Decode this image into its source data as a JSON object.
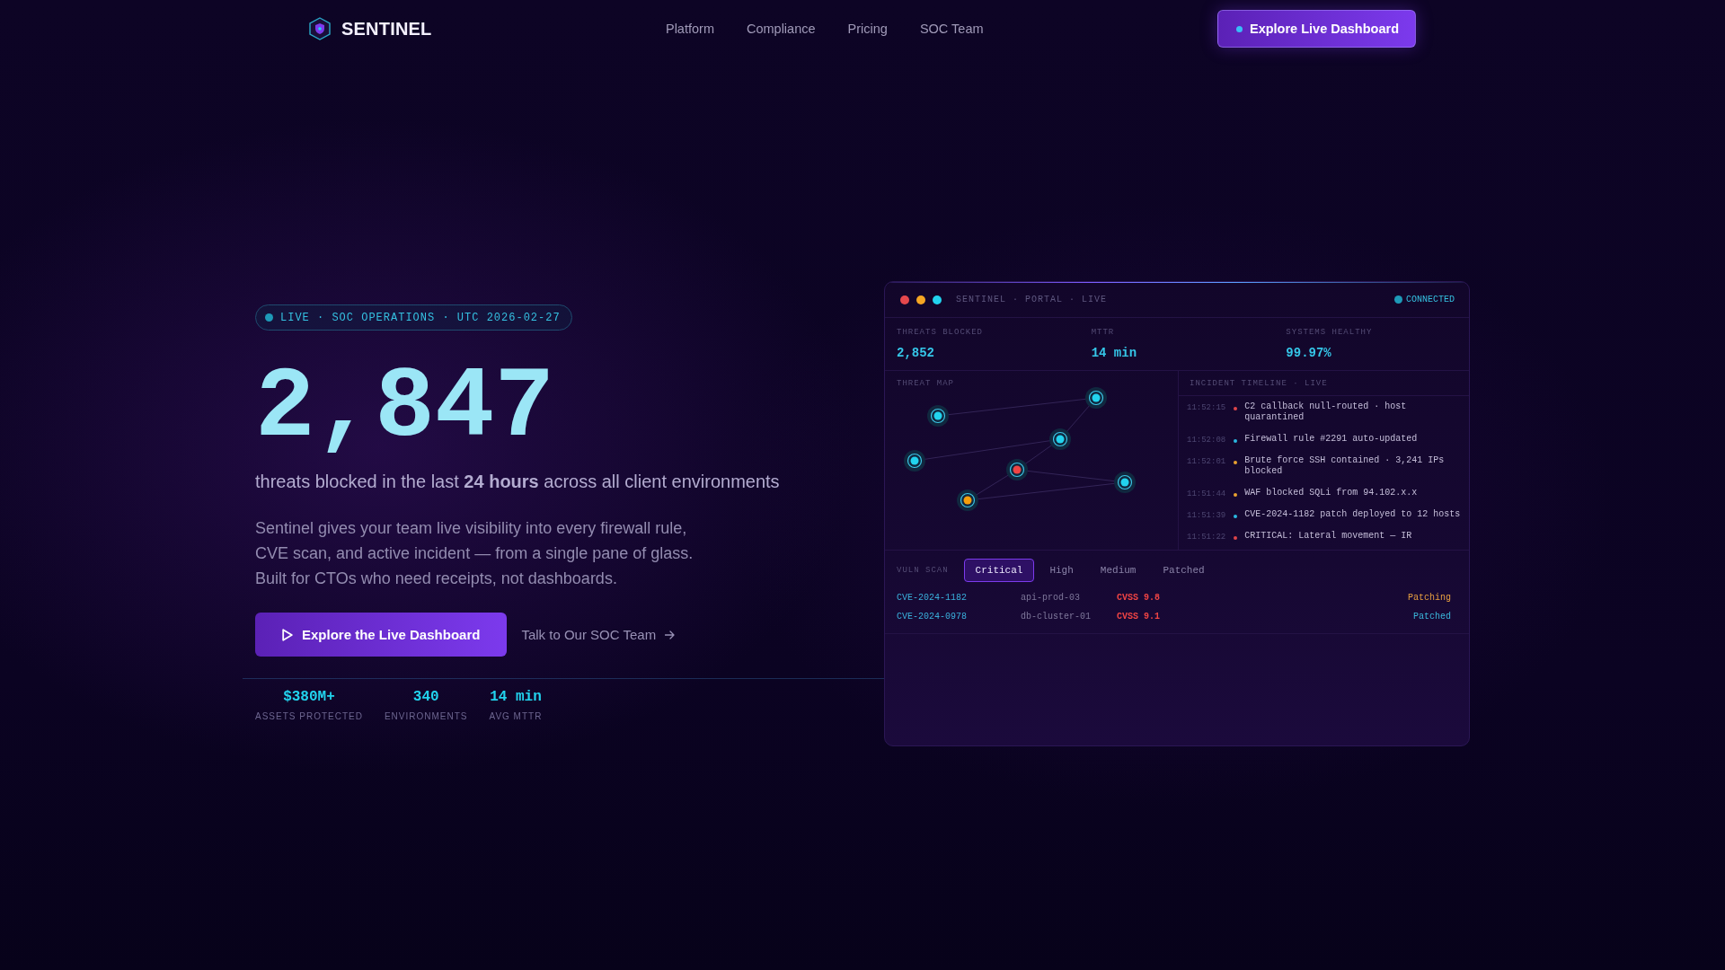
{
  "nav": {
    "brand": "SENTINEL",
    "links": [
      "Platform",
      "Compliance",
      "Pricing",
      "SOC Team"
    ],
    "cta": "Explore Live Dashboard"
  },
  "hero": {
    "badge": "LIVE · SOC OPERATIONS · UTC 2026-02-27",
    "count": "2,847",
    "subtitle": "threats blocked in the last **24 hours** across all client environments",
    "description": "Sentinel gives your team live visibility into every firewall rule, CVE scan, and active incident — from a single pane of glass. Built for CTOs who need receipts, not dashboards.",
    "primary_button": "Explore the Live Dashboard",
    "secondary_link": "Talk to Our SOC Team",
    "stats": [
      {
        "value": "$380M+",
        "label": "ASSETS PROTECTED"
      },
      {
        "value": "340",
        "label": "ENVIRONMENTS"
      },
      {
        "value": "14 min",
        "label": "AVG MTTR"
      }
    ]
  },
  "dashboard": {
    "title": "SENTINEL · PORTAL · LIVE",
    "status": "CONNECTED",
    "metrics": [
      {
        "label": "THREATS BLOCKED",
        "value": "2,852"
      },
      {
        "label": "MTTR",
        "value": "14 min"
      },
      {
        "label": "SYSTEMS HEALTHY",
        "value": "99.97%"
      }
    ],
    "threat_map": {
      "label": "THREAT MAP"
    },
    "timeline": {
      "title": "INCIDENT TIMELINE · LIVE",
      "events": [
        {
          "time": "11:52:15",
          "color": "#e0454a",
          "text": "C2 callback null-routed · host quarantined"
        },
        {
          "time": "11:52:08",
          "color": "#2ab8e0",
          "text": "Firewall rule #2291 auto-updated"
        },
        {
          "time": "11:52:01",
          "color": "#e8a030",
          "text": "Brute force SSH contained · 3,241 IPs blocked"
        },
        {
          "time": "11:51:44",
          "color": "#e8a030",
          "text": "WAF blocked SQLi from 94.102.x.x"
        },
        {
          "time": "11:51:39",
          "color": "#2ab8e0",
          "text": "CVE-2024-1182 patch deployed to 12 hosts"
        },
        {
          "time": "11:51:22",
          "color": "#e0454a",
          "text": "CRITICAL: Lateral movement — IR"
        }
      ]
    },
    "vuln_scan": {
      "label": "VULN SCAN",
      "tabs": [
        {
          "label": "Critical",
          "selected": true
        },
        {
          "label": "High",
          "selected": false
        },
        {
          "label": "Medium",
          "selected": false
        },
        {
          "label": "Patched",
          "selected": false
        }
      ],
      "rows": [
        {
          "cve": "CVE-2024-1182",
          "host": "api-prod-03",
          "score": "CVSS 9.8",
          "status": "Patching",
          "color": "#e8a040"
        },
        {
          "cve": "CVE-2024-0978",
          "host": "db-cluster-01",
          "score": "CVSS 9.1",
          "status": "Patched",
          "color": "#3bb8dc"
        }
      ]
    }
  }
}
